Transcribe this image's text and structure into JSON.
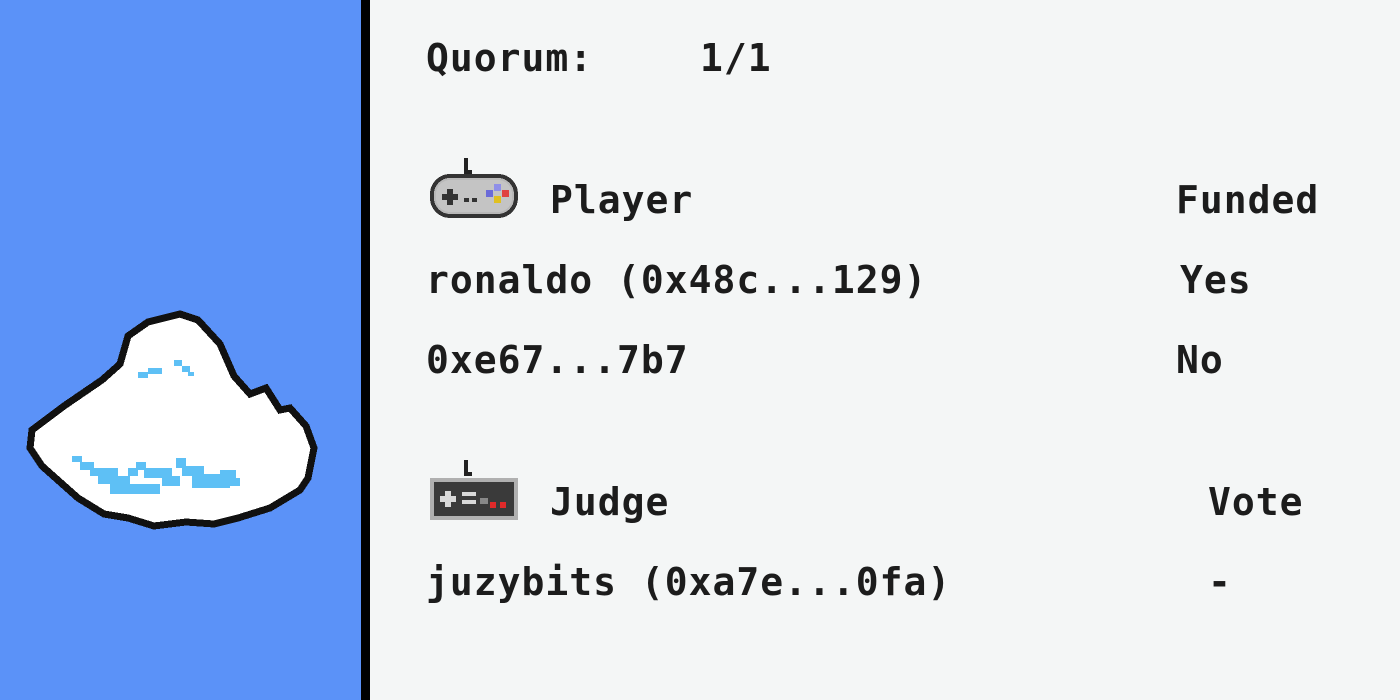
{
  "quorum": {
    "label": "Quorum:",
    "value": "1/1"
  },
  "players": {
    "header": "Player",
    "status_header": "Funded",
    "icon": "snes-controller-icon",
    "rows": [
      {
        "name": "ronaldo (0x48c...129)",
        "status": "Yes"
      },
      {
        "name": "0xe67...7b7",
        "status": "No"
      }
    ]
  },
  "judges": {
    "header": "Judge",
    "status_header": "Vote",
    "icon": "nes-controller-icon",
    "rows": [
      {
        "name": "juzybits (0xa7e...0fa)",
        "status": "-"
      }
    ]
  },
  "colors": {
    "left_panel": "#5b92f8",
    "divider": "#000000",
    "background": "#f4f6f6",
    "text": "#1c1c1c",
    "cloud_highlight": "#5ec0f5"
  }
}
